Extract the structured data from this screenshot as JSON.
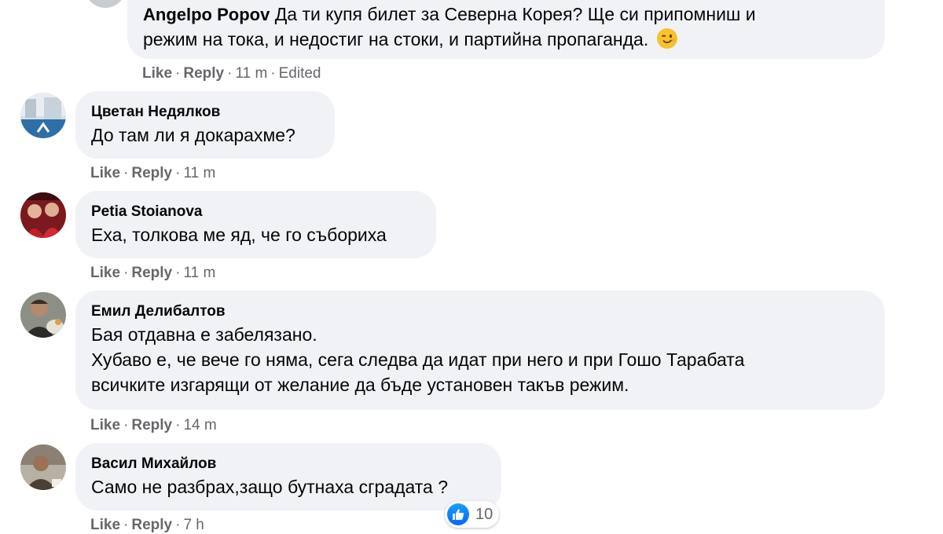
{
  "comments": [
    {
      "author": "Angelpo Popov",
      "text_line1": "Да ти купя билет за Северна Корея? Ще си припомниш и",
      "text_line2": "режим на тока, и недостиг на стоки, и партийна пропаганда.",
      "emoji": "wink-emoji",
      "like": "Like",
      "reply": "Reply",
      "time": "11 m",
      "edited": "Edited"
    },
    {
      "author": "Цветан Недялков",
      "text": "До там ли я докарахме?",
      "like": "Like",
      "reply": "Reply",
      "time": "11 m"
    },
    {
      "author": "Petia Stoianova",
      "text": "Еха, толкова ме яд, че го събориха",
      "like": "Like",
      "reply": "Reply",
      "time": "11 m"
    },
    {
      "author": "Емил Делибалтов",
      "text_line1": "Бая отдавна е забелязано.",
      "text_line2": "Хубаво е, че вече го няма, сега следва да идат при него и при Гошо Тарабата",
      "text_line3": "всичките изгарящи от желание да бъде установен такъв режим.",
      "like": "Like",
      "reply": "Reply",
      "time": "14 m"
    },
    {
      "author": "Васил Михайлов",
      "text": "Само не разбрах,защо бутнаха сградата ?",
      "like": "Like",
      "reply": "Reply",
      "time": "7 h",
      "reactions": {
        "icon": "thumbs-up-icon",
        "count": "10"
      }
    }
  ],
  "colors": {
    "bubble": "#f0f2f5",
    "meta": "#65676b",
    "like_blue": "#0866ff"
  }
}
